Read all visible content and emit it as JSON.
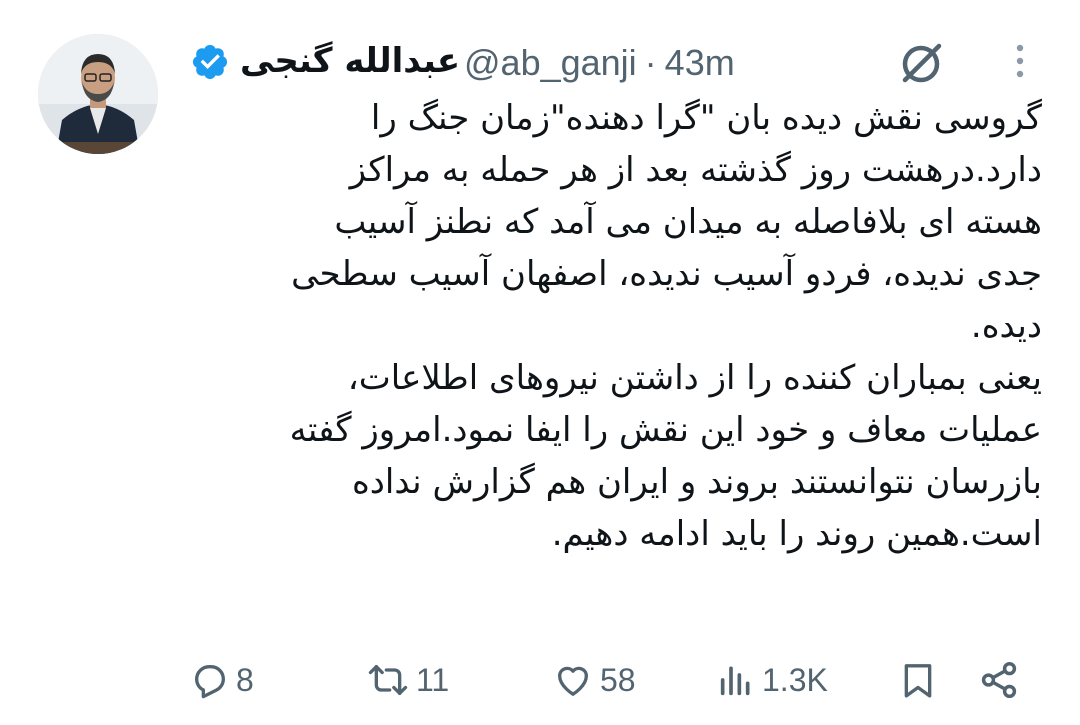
{
  "author": {
    "display_name": "عبدالله گنجی",
    "handle": "@ab_ganji",
    "separator": "·",
    "time": "43m",
    "verified_color": "#1d9bf0"
  },
  "tweet": {
    "lines": [
      "گروسی نقش دیده بان \"گرا دهنده\"زمان جنگ را",
      "دارد.درهشت روز گذشته بعد از هر حمله به مراکز",
      "هسته ای بلافاصله به میدان می آمد که نطنز آسیب",
      "جدی ندیده، فردو آسیب ندیده، اصفهان آسیب سطحی",
      "دیده.",
      "یعنی بمباران کننده را از داشتن نیروهای اطلاعات،",
      "عملیات معاف و خود این نقش را ایفا نمود.امروز گفته",
      "بازرسان نتوانستند بروند و ایران هم گزارش نداده",
      "است.همین روند را باید ادامه دهیم."
    ]
  },
  "actions": {
    "replies": "8",
    "retweets": "11",
    "likes": "58",
    "views": "1.3K"
  },
  "icons": {
    "reply": "reply-icon",
    "retweet": "retweet-icon",
    "like": "heart-icon",
    "views": "views-icon",
    "bookmark": "bookmark-icon",
    "share": "share-icon",
    "grok": "grok-icon",
    "more": "more-icon"
  },
  "colors": {
    "text": "#0f1419",
    "secondary": "#536471",
    "verified": "#1d9bf0"
  }
}
